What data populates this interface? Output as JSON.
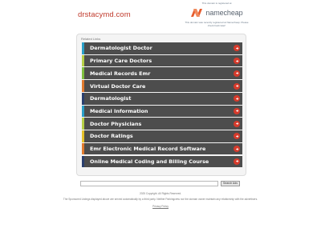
{
  "site": {
    "name": "drstacymd.com"
  },
  "registrar": {
    "top_text": "This domain is registered at",
    "logo_word": "namecheap",
    "note": "This domain was recently registered at Namecheap. Please check back later!",
    "brand_color": "#e65c2e"
  },
  "related": {
    "title": "Related Links",
    "links": [
      {
        "label": "Dermatologist Doctor",
        "accent": "#2aa0c8"
      },
      {
        "label": "Primary Care Doctors",
        "accent": "#b7d046"
      },
      {
        "label": "Medical Records Emr",
        "accent": "#7fbf3f"
      },
      {
        "label": "Virtual Doctor Care",
        "accent": "#e07a2e"
      },
      {
        "label": "Dermatologist",
        "accent": "#2a3f6e"
      },
      {
        "label": "Medical Information",
        "accent": "#2aa0c8"
      },
      {
        "label": "Doctor Physicians",
        "accent": "#b7d046"
      },
      {
        "label": "Doctor Ratings",
        "accent": "#e5c12a"
      },
      {
        "label": "Emr Electronic Medical Record Software",
        "accent": "#e07a2e"
      },
      {
        "label": "Online Medical Coding and Billing Course",
        "accent": "#2a3f6e"
      }
    ],
    "go_color": "#d63a2b"
  },
  "search": {
    "value": "",
    "button_label": "Search Ads"
  },
  "footer": {
    "copyright": "2025 Copyright. All Rights Reserved.",
    "disclaimer": "The Sponsored Listings displayed above are served automatically by a third party. Neither Parkingcrew nor the domain owner maintain any relationship with the advertisers.",
    "privacy_label": "Privacy Policy"
  }
}
